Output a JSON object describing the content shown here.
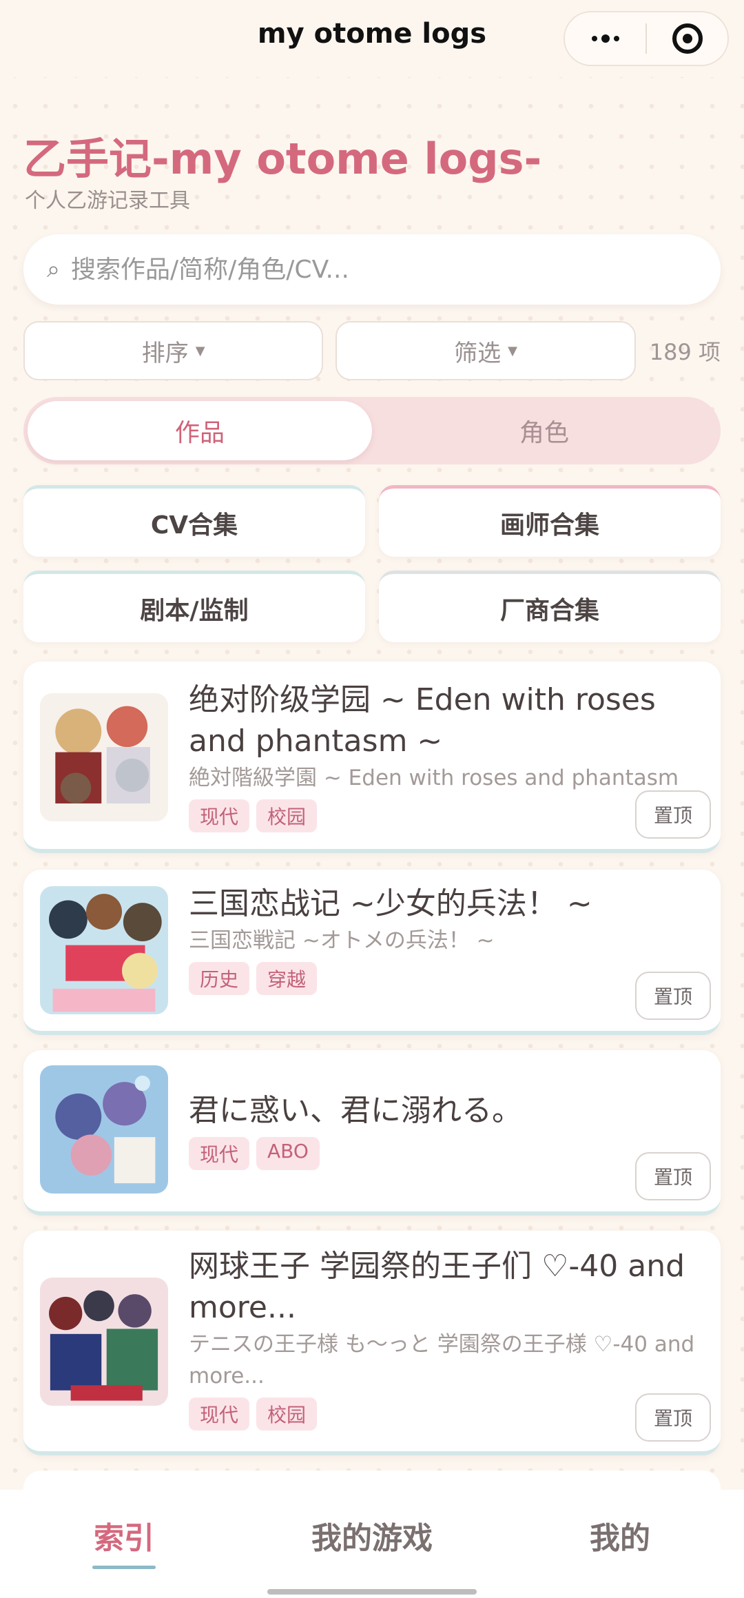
{
  "nav": {
    "title": "my otome logs"
  },
  "header": {
    "title": "乙手记-my otome logs-",
    "subtitle": "个人乙游记录工具"
  },
  "search": {
    "placeholder": "搜索作品/简称/角色/CV..."
  },
  "filters": {
    "sort_label": "排序",
    "filter_label": "筛选",
    "count": "189 项"
  },
  "segment": {
    "works": "作品",
    "characters": "角色",
    "active": "作品"
  },
  "collections": [
    "CV合集",
    "画师合集",
    "剧本/监制",
    "厂商合集"
  ],
  "items": [
    {
      "title": "绝对阶级学园 ~ Eden with roses and phantasm ~",
      "original_title": "絶対階級学園 ~ Eden with roses and phantasm",
      "tags": [
        "现代",
        "校园"
      ],
      "pin_label": "置顶"
    },
    {
      "title": "三国恋战记 ~少女的兵法！ ~",
      "original_title": "三国恋戦記 ~オトメの兵法！ ~",
      "tags": [
        "历史",
        "穿越"
      ],
      "pin_label": "置顶"
    },
    {
      "title": "君に惑い、君に溺れる。",
      "original_title": "",
      "tags": [
        "现代",
        "ABO"
      ],
      "pin_label": "置顶"
    },
    {
      "title": "网球王子 学园祭的王子们 ♡-40 and more...",
      "original_title": "テニスの王子様 も～っと 学園祭の王子様 ♡-40 and more...",
      "tags": [
        "现代",
        "校园"
      ],
      "pin_label": "置顶"
    }
  ],
  "tabbar": {
    "tabs": [
      "索引",
      "我的游戏",
      "我的"
    ],
    "active": "索引"
  },
  "colors": {
    "accent": "#d4697e",
    "background": "#fcf6ef",
    "tag_bg": "#fbe4e8",
    "teal": "#8cb8c7"
  },
  "icons": {
    "search": "search-icon",
    "more": "more-dots-icon",
    "close": "record-target-icon"
  }
}
